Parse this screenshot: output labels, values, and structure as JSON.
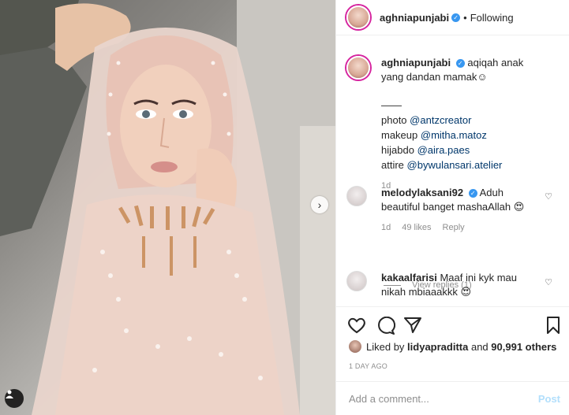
{
  "header": {
    "username": "aghniapunjabi",
    "dot": "•",
    "follow_status": "Following"
  },
  "caption": {
    "username": "aghniapunjabi",
    "text": "aqiqah anak yang dandan mamak",
    "emoji": "☺",
    "separator": "——",
    "credits": [
      {
        "label": "photo",
        "handle": "@antzcreator"
      },
      {
        "label": "makeup",
        "handle": "@mitha.matoz"
      },
      {
        "label": "hijabdo",
        "handle": "@aira.paes"
      },
      {
        "label": "attire",
        "handle": "@bywulansari.atelier"
      }
    ],
    "time": "1d"
  },
  "comments": [
    {
      "username": "melodylaksani92",
      "verified": true,
      "text": "Aduh beautiful banget mashaAllah",
      "emoji": "😍",
      "time": "1d",
      "likes": "49 likes",
      "reply": "Reply",
      "view_replies": "View replies (1)"
    },
    {
      "username": "kakaalfarisi",
      "verified": false,
      "text": "Maaf ini kyk mau nikah mbiaaakkk",
      "emoji": "😍"
    }
  ],
  "likes": {
    "prefix": "Liked by",
    "first_user": "lidyapraditta",
    "connector": "and",
    "others": "90,991 others"
  },
  "date": "1 DAY AGO",
  "add_comment": {
    "placeholder": "Add a comment...",
    "post_label": "Post"
  },
  "colors": {
    "link": "#00376b",
    "verified": "#3897f0",
    "muted": "#8e8e8e",
    "post_disabled": "#b2dffc"
  }
}
